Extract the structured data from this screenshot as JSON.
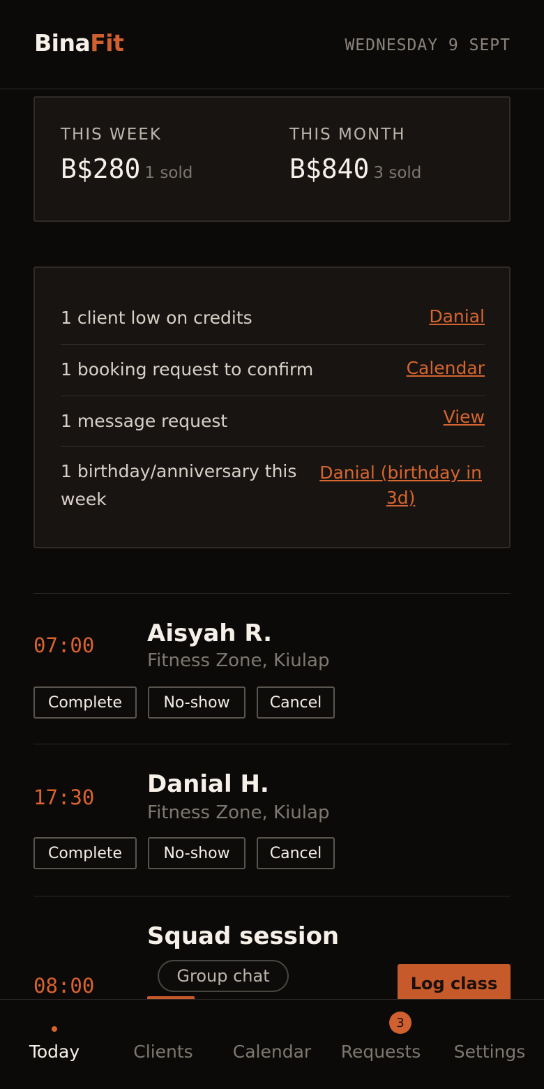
{
  "header": {
    "brand_part1": "Bina",
    "brand_part2": "Fit",
    "date": "WEDNESDAY 9 SEPT"
  },
  "stats": {
    "week": {
      "label": "THIS WEEK",
      "amount": "B$280",
      "sold": "1 sold"
    },
    "month": {
      "label": "THIS MONTH",
      "amount": "B$840",
      "sold": "3 sold"
    }
  },
  "alerts": [
    {
      "text": "1 client low on credits",
      "link": "Danial"
    },
    {
      "text": "1 booking request to confirm",
      "link": "Calendar"
    },
    {
      "text": "1 message request",
      "link": "View"
    },
    {
      "text_line1": "1 birthday/anniversary this",
      "text_line2": "week",
      "link_line1": "Danial (birthday in",
      "link_line2": "3d)"
    }
  ],
  "sessions": [
    {
      "time": "07:00",
      "client": "Aisyah R.",
      "venue": "Fitness Zone, Kiulap",
      "complete": "Complete",
      "noshow": "No-show",
      "cancel": "Cancel"
    },
    {
      "time": "17:30",
      "client": "Danial H.",
      "venue": "Fitness Zone, Kiulap",
      "complete": "Complete",
      "noshow": "No-show",
      "cancel": "Cancel"
    },
    {
      "time": "08:00",
      "client": "Squad session",
      "group_chat": "Group chat",
      "log_class": "Log class"
    }
  ],
  "nav": {
    "items": [
      "Today",
      "Clients",
      "Calendar",
      "Requests",
      "Settings"
    ],
    "requests_badge": "3",
    "active": "Today"
  },
  "colors": {
    "accent": "#d0602f",
    "background": "#0b0a09",
    "card": "#171412"
  }
}
